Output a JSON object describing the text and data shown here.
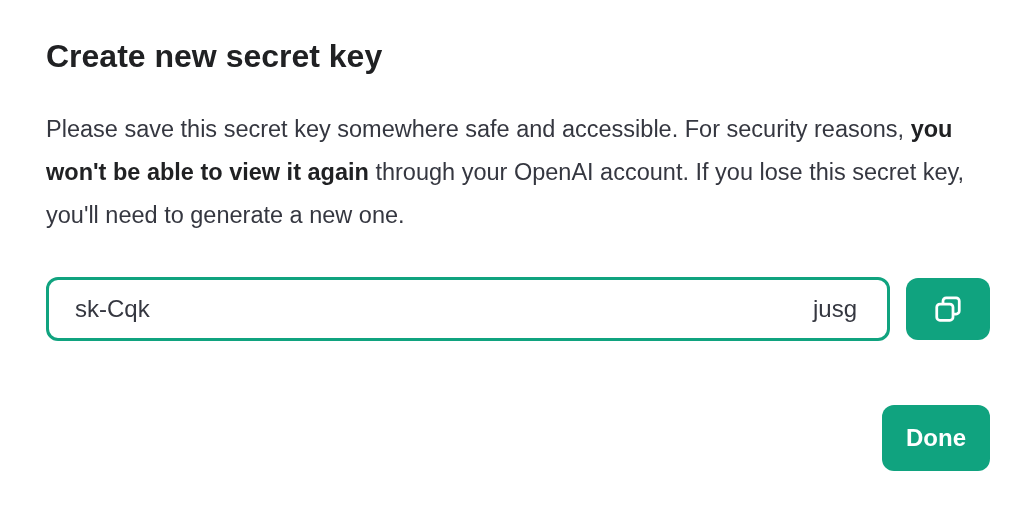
{
  "dialog": {
    "title": "Create new secret key",
    "message": "Please save this secret key somewhere safe and accessible. For security reasons, **you won't be able to view it again** through your OpenAI account. If you lose this secret key, you'll need to generate a new one.",
    "key_field": {
      "value_start": "sk-Cqk",
      "value_end": "jusg",
      "focused": true
    },
    "done_button": "Done"
  }
}
